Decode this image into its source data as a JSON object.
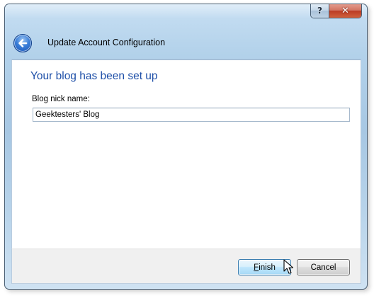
{
  "window": {
    "title": "Update Account Configuration",
    "help_label": "?",
    "close_label": "✕",
    "back_icon": "back-arrow-icon"
  },
  "content": {
    "heading": "Your blog has been set up",
    "nick_label": "Blog nick name:",
    "nick_value": "Geektesters' Blog"
  },
  "buttons": {
    "finish_accel": "F",
    "finish_rest": "inish",
    "cancel_label": "Cancel"
  },
  "colors": {
    "heading": "#1e4fa8",
    "frame": "#b2d1ea",
    "close_button": "#c8452c"
  }
}
